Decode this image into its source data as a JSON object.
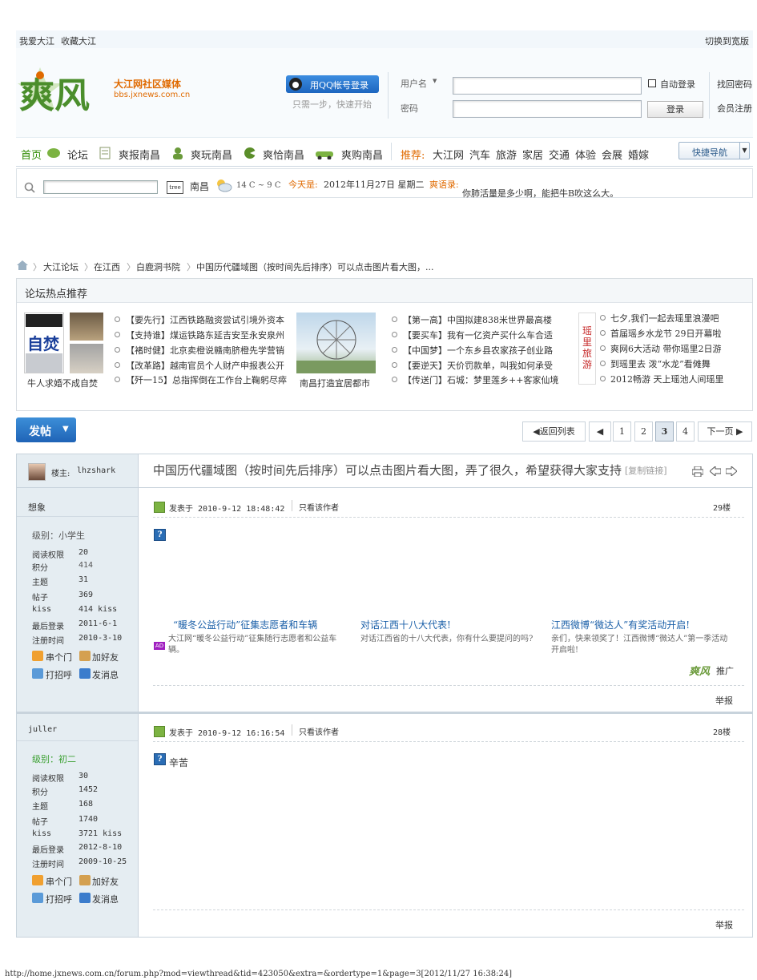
{
  "topbar": {
    "love": "我爱大江",
    "fav": "收藏大江",
    "wide": "切换到宽版"
  },
  "logo": {
    "mark": "爽风",
    "slogan": "大江网社区媒体",
    "domain": "bbs.jxnews.com.cn"
  },
  "login": {
    "qq_button": "用QQ帐号登录",
    "qq_hint": "只需一步，快速开始",
    "username_label": "用户名",
    "password_label": "密码",
    "auto_login": "自动登录",
    "login_button": "登录",
    "find_password": "找回密码",
    "register": "会员注册"
  },
  "nav": {
    "items": [
      "首页",
      "论坛",
      "爽报南昌",
      "爽玩南昌",
      "爽恰南昌",
      "爽购南昌"
    ],
    "recommend_label": "推荐:",
    "recommend": [
      "大江网",
      "汽车",
      "旅游",
      "家居",
      "交通",
      "体验",
      "会展",
      "婚嫁"
    ],
    "quick_nav": "快捷导航"
  },
  "search": {
    "go_label": "tree",
    "city": "南昌",
    "temp": "14 C ~ 9 C",
    "today_label": "今天是:",
    "date": "2012年11月27日 星期二",
    "quote_label": "爽语录:",
    "quote": "你肺活量是多少啊，能把牛B吹这么大。"
  },
  "breadcrumb": [
    "大江论坛",
    "在江西",
    "白鹿洞书院",
    "中国历代疆域图（按时间先后排序）可以点击图片看大图，..."
  ],
  "hot": {
    "title": "论坛热点推荐",
    "img1_caption": "牛人求婚不成自焚",
    "img1_text": "自焚",
    "col1": [
      "【要先行】江西铁路融资尝试引境外资本",
      "【支持谁】煤运铁路东延吉安至永安泉州",
      "【褚时健】北京卖橙说赣南脐橙先学营销",
      "【改革路】越南官员个人财产申报表公开",
      "【歼一15】总指挥倒在工作台上鞠躬尽瘁"
    ],
    "img2_caption": "南昌打造宜居都市",
    "col2": [
      "【第一高】中国拟建838米世界最高楼",
      "【要买车】我有一亿资产买什么车合适",
      "【中国梦】一个东乡县农家孩子创业路",
      "【要逆天】天价罚款单，叫我如何承受",
      "【传送门】石城：梦里莲乡++客家仙境"
    ],
    "badge": "瑶里旅游",
    "col3": [
      "七夕,我们一起去瑶里浪漫吧",
      "首届瑶乡水龙节 29日开幕啦",
      "爽网6大活动 带你瑶里2日游",
      "到瑶里去 泼“水龙”看傩舞",
      "2012畅游 天上瑶池人间瑶里"
    ]
  },
  "toolbar": {
    "post": "发帖",
    "back": "返回列表",
    "pages": [
      "1",
      "2",
      "3",
      "4"
    ],
    "current_page": "3",
    "next": "下一页"
  },
  "thread": {
    "op_label": "楼主:",
    "op_name": "lhzshark",
    "title": "中国历代疆域图（按时间先后排序）可以点击图片看大图，弄了很久，希望获得大家支持",
    "copy_link": "[复制链接]"
  },
  "posts": [
    {
      "author": "想象",
      "level": "级别：小学生",
      "stats_labels": [
        "阅读权限",
        "积分",
        "主题",
        "帖子",
        "kiss",
        "最后登录",
        "注册时间"
      ],
      "stats_values": [
        "20",
        "414",
        "31",
        "369",
        "414 kiss",
        "2011-6-1",
        "2010-3-10"
      ],
      "actions": [
        "串个门",
        "加好友",
        "打招呼",
        "发消息"
      ],
      "posted": "发表于 2010-9-12 18:48:42",
      "only_author": "只看该作者",
      "floor": "29楼",
      "content": "",
      "report": "举报",
      "ads": [
        {
          "title": "“暖冬公益行动”征集志愿者和车辆",
          "desc": "大江网“暖冬公益行动”征集随行志愿者和公益车辆。"
        },
        {
          "title": "对话江西十八大代表!",
          "desc": "对话江西省的十八大代表，你有什么要提问的吗?"
        },
        {
          "title": "江西微博“微达人”有奖活动开启!",
          "desc": "亲们，快来领奖了！江西微博“微达人”第一季活动开启啦!"
        }
      ],
      "ad_mark": "AD",
      "promo_brand": "爽风",
      "promo_label": "推广"
    },
    {
      "author": "juller",
      "level": "级别：初二",
      "stats_labels": [
        "阅读权限",
        "积分",
        "主题",
        "帖子",
        "kiss",
        "最后登录",
        "注册时间"
      ],
      "stats_values": [
        "30",
        "1452",
        "168",
        "1740",
        "3721 kiss",
        "2012-8-10",
        "2009-10-25"
      ],
      "actions": [
        "串个门",
        "加好友",
        "打招呼",
        "发消息"
      ],
      "posted": "发表于 2010-9-12 16:16:54",
      "only_author": "只看该作者",
      "floor": "28楼",
      "content": "辛苦",
      "report": "举报"
    }
  ],
  "footer_url": "http://home.jxnews.com.cn/forum.php?mod=viewthread&tid=423050&extra=&ordertype=1&page=3[2012/11/27 16:38:24]",
  "colors": {
    "accent_orange": "#e06a00",
    "nav_green": "#2e8b00",
    "link_blue": "#1a5fa8",
    "sidebar_bg": "#e5edf2"
  }
}
